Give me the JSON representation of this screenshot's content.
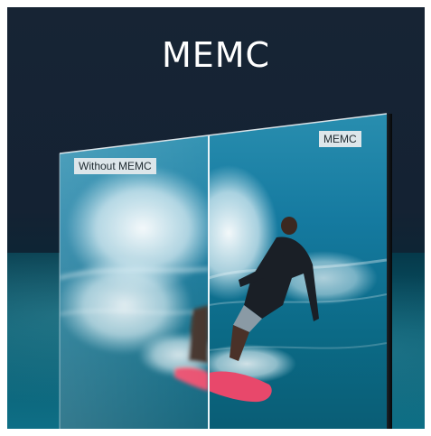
{
  "headline": "MEMC",
  "labels": {
    "left": "Without MEMC",
    "right": "MEMC"
  }
}
